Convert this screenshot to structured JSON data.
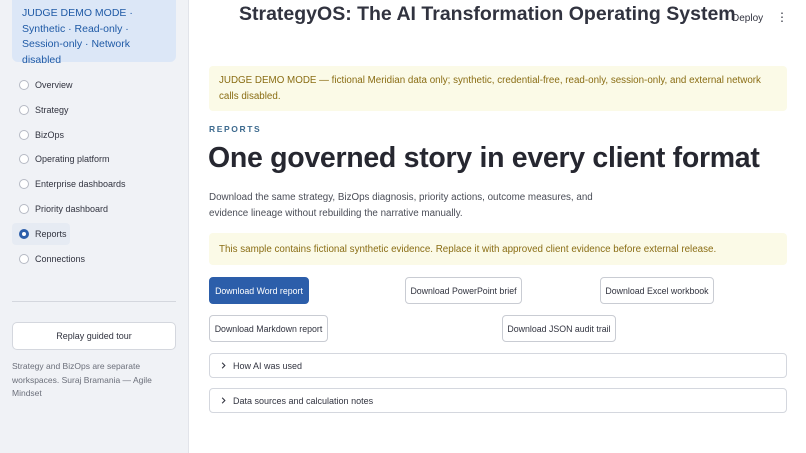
{
  "sidebar": {
    "demo_badge": "JUDGE DEMO MODE · Synthetic · Read-only · Session-only · Network disabled",
    "nav_items": [
      {
        "label": "Overview",
        "selected": false
      },
      {
        "label": "Strategy",
        "selected": false
      },
      {
        "label": "BizOps",
        "selected": false
      },
      {
        "label": "Operating platform",
        "selected": false
      },
      {
        "label": "Enterprise dashboards",
        "selected": false
      },
      {
        "label": "Priority dashboard",
        "selected": false
      },
      {
        "label": "Reports",
        "selected": true
      },
      {
        "label": "Connections",
        "selected": false
      }
    ],
    "tour_button": "Replay guided tour",
    "footer": "Strategy and BizOps are separate workspaces. Suraj Bramania — Agile Mindset"
  },
  "header": {
    "title": "StrategyOS: The AI Transformation Operating System",
    "deploy_label": "Deploy",
    "menu_icon": "kebab-menu-icon"
  },
  "main": {
    "warning": "JUDGE DEMO MODE — fictional Meridian data only; synthetic, credential-free, read-only, session-only, and external network calls disabled.",
    "eyebrow": "REPORTS",
    "headline": "One governed story in every client format",
    "description": "Download the same strategy, BizOps diagnosis, priority actions, outcome measures, and evidence lineage without rebuilding the narrative manually.",
    "notice": "This sample contains fictional synthetic evidence. Replace it with approved client evidence before external release.",
    "buttons": {
      "word": "Download Word report",
      "powerpoint": "Download PowerPoint brief",
      "excel": "Download Excel workbook",
      "markdown": "Download Markdown report",
      "json": "Download JSON audit trail"
    },
    "expanders": {
      "ai": "How AI was used",
      "sources": "Data sources and calculation notes"
    }
  },
  "colors": {
    "primary": "#2c5eaa",
    "sidebar_bg": "#f0f2f6",
    "badge_bg": "#dce7f7",
    "warning_bg": "#fbfae7",
    "warning_text": "#8a6d14"
  }
}
